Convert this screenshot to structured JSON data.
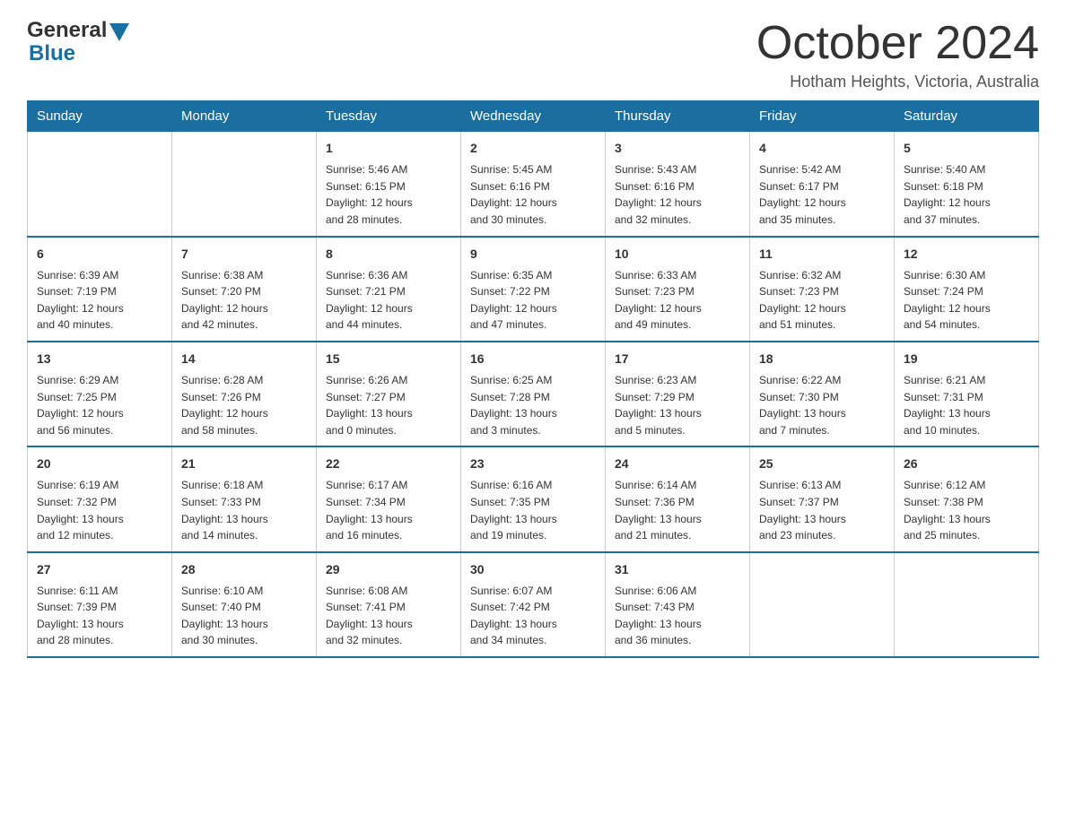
{
  "header": {
    "logo_general": "General",
    "logo_blue": "Blue",
    "title": "October 2024",
    "subtitle": "Hotham Heights, Victoria, Australia"
  },
  "weekdays": [
    "Sunday",
    "Monday",
    "Tuesday",
    "Wednesday",
    "Thursday",
    "Friday",
    "Saturday"
  ],
  "weeks": [
    [
      {
        "day": "",
        "info": ""
      },
      {
        "day": "",
        "info": ""
      },
      {
        "day": "1",
        "info": "Sunrise: 5:46 AM\nSunset: 6:15 PM\nDaylight: 12 hours\nand 28 minutes."
      },
      {
        "day": "2",
        "info": "Sunrise: 5:45 AM\nSunset: 6:16 PM\nDaylight: 12 hours\nand 30 minutes."
      },
      {
        "day": "3",
        "info": "Sunrise: 5:43 AM\nSunset: 6:16 PM\nDaylight: 12 hours\nand 32 minutes."
      },
      {
        "day": "4",
        "info": "Sunrise: 5:42 AM\nSunset: 6:17 PM\nDaylight: 12 hours\nand 35 minutes."
      },
      {
        "day": "5",
        "info": "Sunrise: 5:40 AM\nSunset: 6:18 PM\nDaylight: 12 hours\nand 37 minutes."
      }
    ],
    [
      {
        "day": "6",
        "info": "Sunrise: 6:39 AM\nSunset: 7:19 PM\nDaylight: 12 hours\nand 40 minutes."
      },
      {
        "day": "7",
        "info": "Sunrise: 6:38 AM\nSunset: 7:20 PM\nDaylight: 12 hours\nand 42 minutes."
      },
      {
        "day": "8",
        "info": "Sunrise: 6:36 AM\nSunset: 7:21 PM\nDaylight: 12 hours\nand 44 minutes."
      },
      {
        "day": "9",
        "info": "Sunrise: 6:35 AM\nSunset: 7:22 PM\nDaylight: 12 hours\nand 47 minutes."
      },
      {
        "day": "10",
        "info": "Sunrise: 6:33 AM\nSunset: 7:23 PM\nDaylight: 12 hours\nand 49 minutes."
      },
      {
        "day": "11",
        "info": "Sunrise: 6:32 AM\nSunset: 7:23 PM\nDaylight: 12 hours\nand 51 minutes."
      },
      {
        "day": "12",
        "info": "Sunrise: 6:30 AM\nSunset: 7:24 PM\nDaylight: 12 hours\nand 54 minutes."
      }
    ],
    [
      {
        "day": "13",
        "info": "Sunrise: 6:29 AM\nSunset: 7:25 PM\nDaylight: 12 hours\nand 56 minutes."
      },
      {
        "day": "14",
        "info": "Sunrise: 6:28 AM\nSunset: 7:26 PM\nDaylight: 12 hours\nand 58 minutes."
      },
      {
        "day": "15",
        "info": "Sunrise: 6:26 AM\nSunset: 7:27 PM\nDaylight: 13 hours\nand 0 minutes."
      },
      {
        "day": "16",
        "info": "Sunrise: 6:25 AM\nSunset: 7:28 PM\nDaylight: 13 hours\nand 3 minutes."
      },
      {
        "day": "17",
        "info": "Sunrise: 6:23 AM\nSunset: 7:29 PM\nDaylight: 13 hours\nand 5 minutes."
      },
      {
        "day": "18",
        "info": "Sunrise: 6:22 AM\nSunset: 7:30 PM\nDaylight: 13 hours\nand 7 minutes."
      },
      {
        "day": "19",
        "info": "Sunrise: 6:21 AM\nSunset: 7:31 PM\nDaylight: 13 hours\nand 10 minutes."
      }
    ],
    [
      {
        "day": "20",
        "info": "Sunrise: 6:19 AM\nSunset: 7:32 PM\nDaylight: 13 hours\nand 12 minutes."
      },
      {
        "day": "21",
        "info": "Sunrise: 6:18 AM\nSunset: 7:33 PM\nDaylight: 13 hours\nand 14 minutes."
      },
      {
        "day": "22",
        "info": "Sunrise: 6:17 AM\nSunset: 7:34 PM\nDaylight: 13 hours\nand 16 minutes."
      },
      {
        "day": "23",
        "info": "Sunrise: 6:16 AM\nSunset: 7:35 PM\nDaylight: 13 hours\nand 19 minutes."
      },
      {
        "day": "24",
        "info": "Sunrise: 6:14 AM\nSunset: 7:36 PM\nDaylight: 13 hours\nand 21 minutes."
      },
      {
        "day": "25",
        "info": "Sunrise: 6:13 AM\nSunset: 7:37 PM\nDaylight: 13 hours\nand 23 minutes."
      },
      {
        "day": "26",
        "info": "Sunrise: 6:12 AM\nSunset: 7:38 PM\nDaylight: 13 hours\nand 25 minutes."
      }
    ],
    [
      {
        "day": "27",
        "info": "Sunrise: 6:11 AM\nSunset: 7:39 PM\nDaylight: 13 hours\nand 28 minutes."
      },
      {
        "day": "28",
        "info": "Sunrise: 6:10 AM\nSunset: 7:40 PM\nDaylight: 13 hours\nand 30 minutes."
      },
      {
        "day": "29",
        "info": "Sunrise: 6:08 AM\nSunset: 7:41 PM\nDaylight: 13 hours\nand 32 minutes."
      },
      {
        "day": "30",
        "info": "Sunrise: 6:07 AM\nSunset: 7:42 PM\nDaylight: 13 hours\nand 34 minutes."
      },
      {
        "day": "31",
        "info": "Sunrise: 6:06 AM\nSunset: 7:43 PM\nDaylight: 13 hours\nand 36 minutes."
      },
      {
        "day": "",
        "info": ""
      },
      {
        "day": "",
        "info": ""
      }
    ]
  ]
}
